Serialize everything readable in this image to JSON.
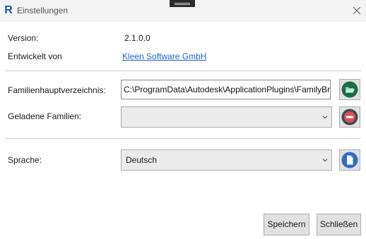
{
  "window": {
    "title": "Einstellungen",
    "app_icon_letter": "R"
  },
  "info": {
    "version_label": "Version:",
    "version_value": "2.1.0.0",
    "developer_label": "Entwickelt von",
    "developer_value": "Kleen Software GmbH"
  },
  "families": {
    "root_dir_label": "Familienhauptverzeichnis:",
    "root_dir_value": "C:\\ProgramData\\Autodesk\\ApplicationPlugins\\FamilyBro",
    "loaded_label": "Geladene Familien:",
    "loaded_value": ""
  },
  "language": {
    "label": "Sprache:",
    "selected": "Deutsch"
  },
  "footer": {
    "save_label": "Speichern",
    "close_label": "Schließen"
  },
  "colors": {
    "folder_button": "#1e6b4c",
    "remove_button": "#3f4a55",
    "file_button": "#2f6cc7",
    "remove_bar": "#d9534f",
    "link": "#1d63c9"
  },
  "icons": {
    "close": "close-icon",
    "folder": "folder-open-icon",
    "remove": "remove-icon",
    "file": "document-icon",
    "dropdown": "chevron-down-icon"
  }
}
